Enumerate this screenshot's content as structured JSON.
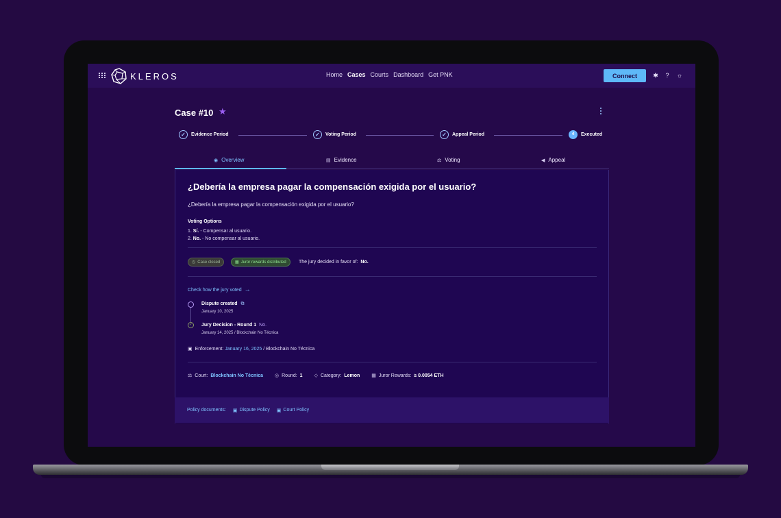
{
  "header": {
    "logo_text": "KLEROS",
    "nav": [
      "Home",
      "Cases",
      "Courts",
      "Dashboard",
      "Get PNK"
    ],
    "active_nav": "Cases",
    "connect_label": "Connect",
    "icons": [
      "settings-icon",
      "help-icon",
      "theme-icon"
    ]
  },
  "case": {
    "title": "Case #10",
    "steps": [
      {
        "label": "Evidence Period",
        "state": "done"
      },
      {
        "label": "Voting Period",
        "state": "done"
      },
      {
        "label": "Appeal Period",
        "state": "done"
      },
      {
        "label": "Executed",
        "state": "current",
        "number": "4"
      }
    ],
    "tabs": [
      {
        "label": "Overview",
        "icon": "eye-icon",
        "active": true
      },
      {
        "label": "Evidence",
        "icon": "document-icon",
        "active": false
      },
      {
        "label": "Voting",
        "icon": "scale-icon",
        "active": false
      },
      {
        "label": "Appeal",
        "icon": "megaphone-icon",
        "active": false
      }
    ]
  },
  "overview": {
    "question_title": "¿Debería la empresa pagar la compensación exigida por el usuario?",
    "question_desc": "¿Debería la empresa pagar la compensación exigida por el usuario?",
    "voting_options_title": "Voting Options",
    "options": [
      {
        "num": "1.",
        "label": "Sí.",
        "desc": "- Compensar al usuario."
      },
      {
        "num": "2.",
        "label": "No.",
        "desc": "- No compensar al usuario."
      }
    ],
    "badges": {
      "closed": "Case closed",
      "rewards": "Juror rewards distributed"
    },
    "decided_text": "The jury decided in favor of:",
    "decided_value": "No.",
    "check_link": "Check how the jury voted",
    "timeline": [
      {
        "title": "Dispute created",
        "date": "January 10, 2025"
      },
      {
        "title": "Jury Decision - Round 1",
        "vote": "No.",
        "date": "January 14, 2025 / Blockchain No Técnica"
      }
    ],
    "enforcement_label": "Enforcement:",
    "enforcement_date": "January 16, 2025",
    "enforcement_court": "/ Blockchain No Técnica",
    "meta": {
      "court_label": "Court:",
      "court_value": "Blockchain No Técnica",
      "round_label": "Round:",
      "round_value": "1",
      "category_label": "Category:",
      "category_value": "Lemon",
      "rewards_label": "Juror Rewards:",
      "rewards_value": "≥ 0.0054 ETH"
    },
    "policy": {
      "label": "Policy documents:",
      "dispute": "Dispute Policy",
      "court": "Court Policy"
    }
  }
}
